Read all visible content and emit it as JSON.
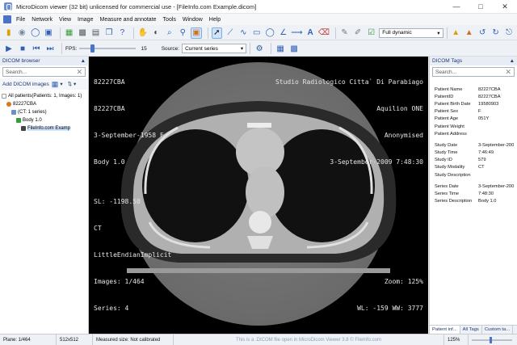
{
  "window": {
    "title": "MicroDicom viewer (32 bit) unlicensed for commercial use - [FileInfo.com Example.dicom]"
  },
  "menu": [
    "File",
    "Network",
    "View",
    "Image",
    "Measure and annotate",
    "Tools",
    "Window",
    "Help"
  ],
  "toolbar": {
    "window_preset": "Full dynamic"
  },
  "toolbar2": {
    "fps_label": "FPS:",
    "fps_value": "15",
    "source_label": "Source:",
    "source_value": "Current series"
  },
  "left_panel": {
    "title": "DICOM browser",
    "search_placeholder": "Search...",
    "add_label": "Add DICOM images",
    "tree": [
      {
        "label": "All patients(Patients: 1, Images: 1)",
        "level": 0
      },
      {
        "label": "82227CBA",
        "level": 1
      },
      {
        "label": "(CT: 1 series)",
        "level": 2
      },
      {
        "label": "Body 1.0",
        "level": 3
      },
      {
        "label": "FileInfo.com Examp",
        "level": 4
      }
    ]
  },
  "viewer": {
    "top_left": [
      "82227CBA",
      "82227CBA",
      "3-September-1958 F",
      "Body 1.0"
    ],
    "top_right": [
      "Studio Radiologico Citta` Di Parabiago",
      "Aquilion ONE",
      "Anonymised",
      "3-September-2009 7:48:30"
    ],
    "bottom_left": [
      "SL: -1198.50",
      "CT",
      "LittleEndianImplicit",
      "Images: 1/464",
      "Series: 4"
    ],
    "bottom_right": [
      "Zoom: 125%",
      "WL: -159 WW: 3777"
    ]
  },
  "right_panel": {
    "title": "DICOM Tags",
    "search_placeholder": "Search...",
    "groups": [
      [
        {
          "k": "Patient Name",
          "v": "82227CBA"
        },
        {
          "k": "PatientID",
          "v": "82227CBA"
        },
        {
          "k": "Patient Birth Date",
          "v": "19580903"
        },
        {
          "k": "Patient Sex",
          "v": "F"
        },
        {
          "k": "Patient Age",
          "v": "051Y"
        },
        {
          "k": "Patient Weight",
          "v": ""
        },
        {
          "k": "Patient Address",
          "v": ""
        }
      ],
      [
        {
          "k": "Study Date",
          "v": "3-September-200"
        },
        {
          "k": "Study Time",
          "v": "7:46:49"
        },
        {
          "k": "Study ID",
          "v": "579"
        },
        {
          "k": "Study Modality",
          "v": "CT"
        },
        {
          "k": "Study Description",
          "v": ""
        }
      ],
      [
        {
          "k": "Series Date",
          "v": "3-September-200"
        },
        {
          "k": "Series Time",
          "v": "7:48:30"
        },
        {
          "k": "Series Description",
          "v": "Body 1.0"
        }
      ]
    ],
    "tabs": [
      "Patient inf...",
      "All Tags",
      "Custom ta..."
    ]
  },
  "status": {
    "plane": "Plane: 1/464",
    "size": "512x512",
    "measured": "Measured size: Not calibrated",
    "center": "This is a .DICOM file open in MicroDicom Viewer 3.8 © FileInfo.com",
    "zoom": "125%"
  },
  "colors": {
    "accent": "#3060b0",
    "viewer_bg": "#000000",
    "overlay_text": "#e6e6e6"
  }
}
